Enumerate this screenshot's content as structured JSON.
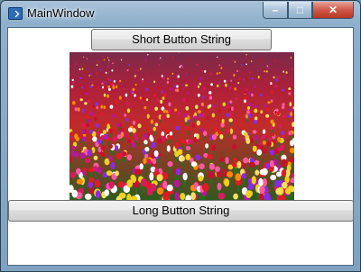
{
  "window": {
    "title": "MainWindow"
  },
  "title_controls": {
    "minimize_glyph": "–",
    "maximize_glyph": "□",
    "close_glyph": "✕"
  },
  "buttons": {
    "short_label": "Short Button String",
    "long_label": "Long Button String"
  },
  "image": {
    "subject": "tulip-field-photo"
  }
}
